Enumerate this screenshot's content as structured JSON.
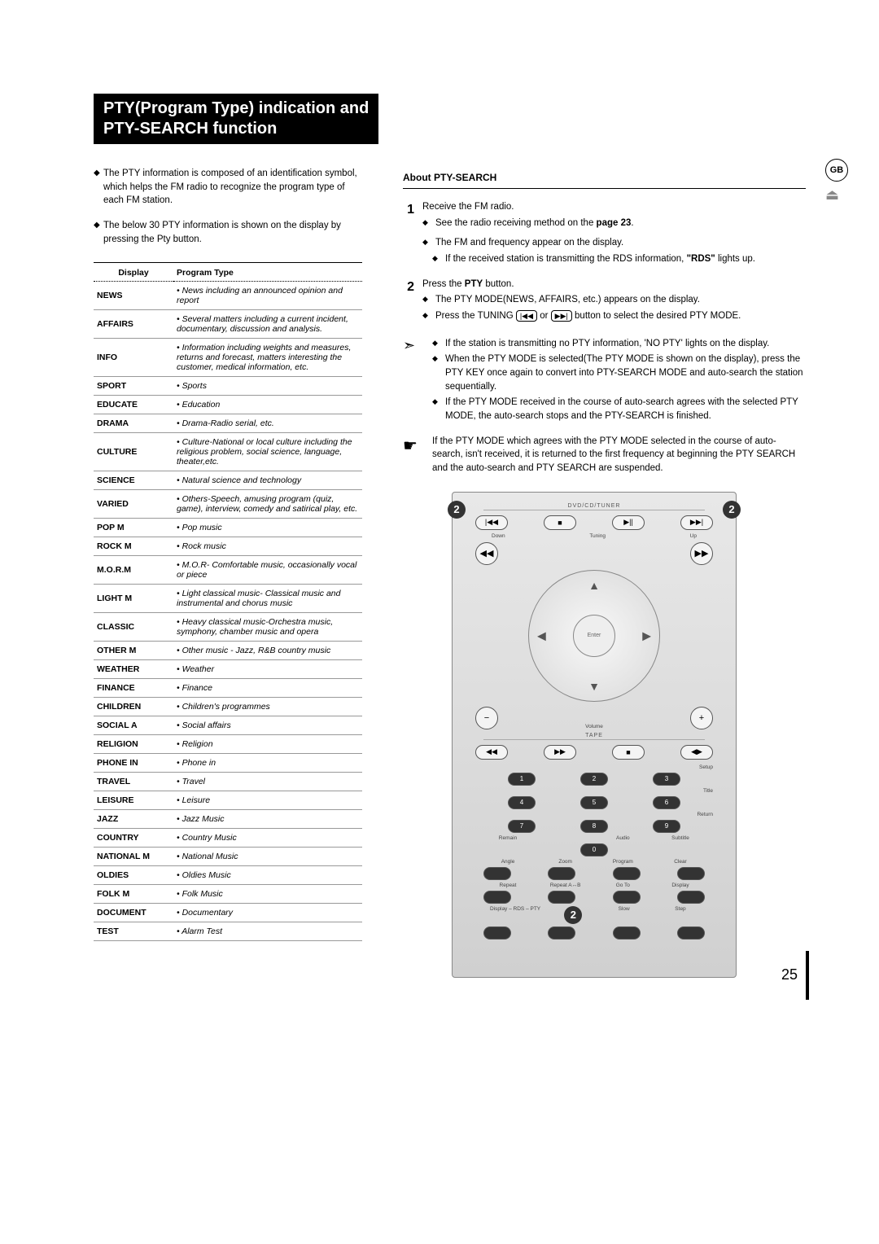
{
  "region_badge": "GB",
  "title_line1": "PTY(Program Type) indication and",
  "title_line2": "PTY-SEARCH function",
  "intro": [
    "The PTY information is composed of an identification symbol, which helps the FM radio to recognize the program type of each FM station.",
    "The below 30 PTY information is shown on the display by pressing the Pty button."
  ],
  "table_headers": {
    "display": "Display",
    "ptype": "Program Type"
  },
  "pty_rows": [
    {
      "d": "NEWS",
      "t": "• News including an announced opinion and report"
    },
    {
      "d": "AFFAIRS",
      "t": "• Several matters including a current incident, documentary, discussion and analysis."
    },
    {
      "d": "INFO",
      "t": "• Information including weights and measures, returns and forecast, matters interesting the customer, medical information, etc."
    },
    {
      "d": "SPORT",
      "t": "• Sports"
    },
    {
      "d": "EDUCATE",
      "t": "• Education"
    },
    {
      "d": "DRAMA",
      "t": "• Drama-Radio serial, etc."
    },
    {
      "d": "CULTURE",
      "t": "• Culture-National or local culture including the religious problem, social science, language, theater,etc."
    },
    {
      "d": "SCIENCE",
      "t": "• Natural science and technology"
    },
    {
      "d": "VARIED",
      "t": "• Others-Speech, amusing program (quiz, game), interview, comedy and satirical play, etc."
    },
    {
      "d": "POP M",
      "t": "• Pop music"
    },
    {
      "d": "ROCK M",
      "t": "• Rock music"
    },
    {
      "d": "M.O.R.M",
      "t": "• M.O.R- Comfortable music, occasionally vocal or piece"
    },
    {
      "d": "LIGHT M",
      "t": "• Light classical music- Classical music and instrumental and chorus music"
    },
    {
      "d": "CLASSIC",
      "t": "• Heavy classical  music-Orchestra music, symphony, chamber music and opera"
    },
    {
      "d": "OTHER M",
      "t": "• Other music - Jazz, R&B country music"
    },
    {
      "d": "WEATHER",
      "t": "• Weather"
    },
    {
      "d": "FINANCE",
      "t": "• Finance"
    },
    {
      "d": "CHILDREN",
      "t": "• Children's programmes"
    },
    {
      "d": "SOCIAL  A",
      "t": "• Social affairs"
    },
    {
      "d": "RELIGION",
      "t": "• Religion"
    },
    {
      "d": "PHONE IN",
      "t": "• Phone in"
    },
    {
      "d": "TRAVEL",
      "t": "• Travel"
    },
    {
      "d": "LEISURE",
      "t": "• Leisure"
    },
    {
      "d": "JAZZ",
      "t": "• Jazz Music"
    },
    {
      "d": "COUNTRY",
      "t": "• Country Music"
    },
    {
      "d": "NATIONAL M",
      "t": "• National Music"
    },
    {
      "d": "OLDIES",
      "t": "• Oldies Music"
    },
    {
      "d": "FOLK M",
      "t": "• Folk Music"
    },
    {
      "d": "DOCUMENT",
      "t": "• Documentary"
    },
    {
      "d": "TEST",
      "t": "• Alarm Test"
    }
  ],
  "right_header": "About PTY-SEARCH",
  "step1": {
    "title": "Receive the FM radio.",
    "sub1_pre": "See the radio receiving method on the ",
    "sub1_bold": "page 23",
    "sub1_post": ".",
    "bullet2": "The FM and frequency appear on the display.",
    "bullet2_sub_pre": "If the received station is transmitting the RDS information, ",
    "bullet2_sub_bold": "\"RDS\"",
    "bullet2_sub_post": " lights up."
  },
  "step2": {
    "title_pre": "Press the ",
    "title_bold": "PTY",
    "title_post": " button.",
    "bullet1": "The PTY MODE(NEWS, AFFAIRS, etc.) appears on the display.",
    "bullet2_pre": "Press the TUNING ",
    "bullet2_mid": " or ",
    "bullet2_post": " button to select the desired PTY MODE."
  },
  "note_group": [
    "If the station is transmitting no PTY information, 'NO PTY' lights on the display.",
    "When the PTY MODE is selected(The PTY MODE is shown on the display), press the PTY KEY once again to convert into PTY-SEARCH MODE and auto-search the station sequentially.",
    "If the PTY MODE received in the course of auto-search agrees with the selected PTY MODE, the auto-search stops and the PTY-SEARCH is finished."
  ],
  "hand_note": "If the PTY MODE which agrees with the PTY MODE selected in the course of auto-search, isn't received, it is returned to the first frequency at beginning the PTY SEARCH and the auto-search and PTY SEARCH are suspended.",
  "remote": {
    "top_label": "DVD/CD/TUNER",
    "tuning_down": "Down",
    "tuning": "Tuning",
    "tuning_up": "Up",
    "enter": "Enter",
    "volume": "Volume",
    "tape": "TAPE",
    "setup": "Setup",
    "title": "Title",
    "return": "Return",
    "row_remain": "Remain",
    "row_audio": "Audio",
    "row_subtitle": "Subtitle",
    "row_angle": "Angle",
    "row_zoom": "Zoom",
    "row_program": "Program",
    "row_clear": "Clear",
    "row_repeat": "Repeat",
    "row_repeatab": "Repeat A↔B",
    "row_goto": "Go To",
    "row_display": "Display",
    "row_rds": "Display – RDS – PTY",
    "row_slow": "Slow",
    "row_step": "Step"
  },
  "page_number": "25",
  "callout": "2"
}
